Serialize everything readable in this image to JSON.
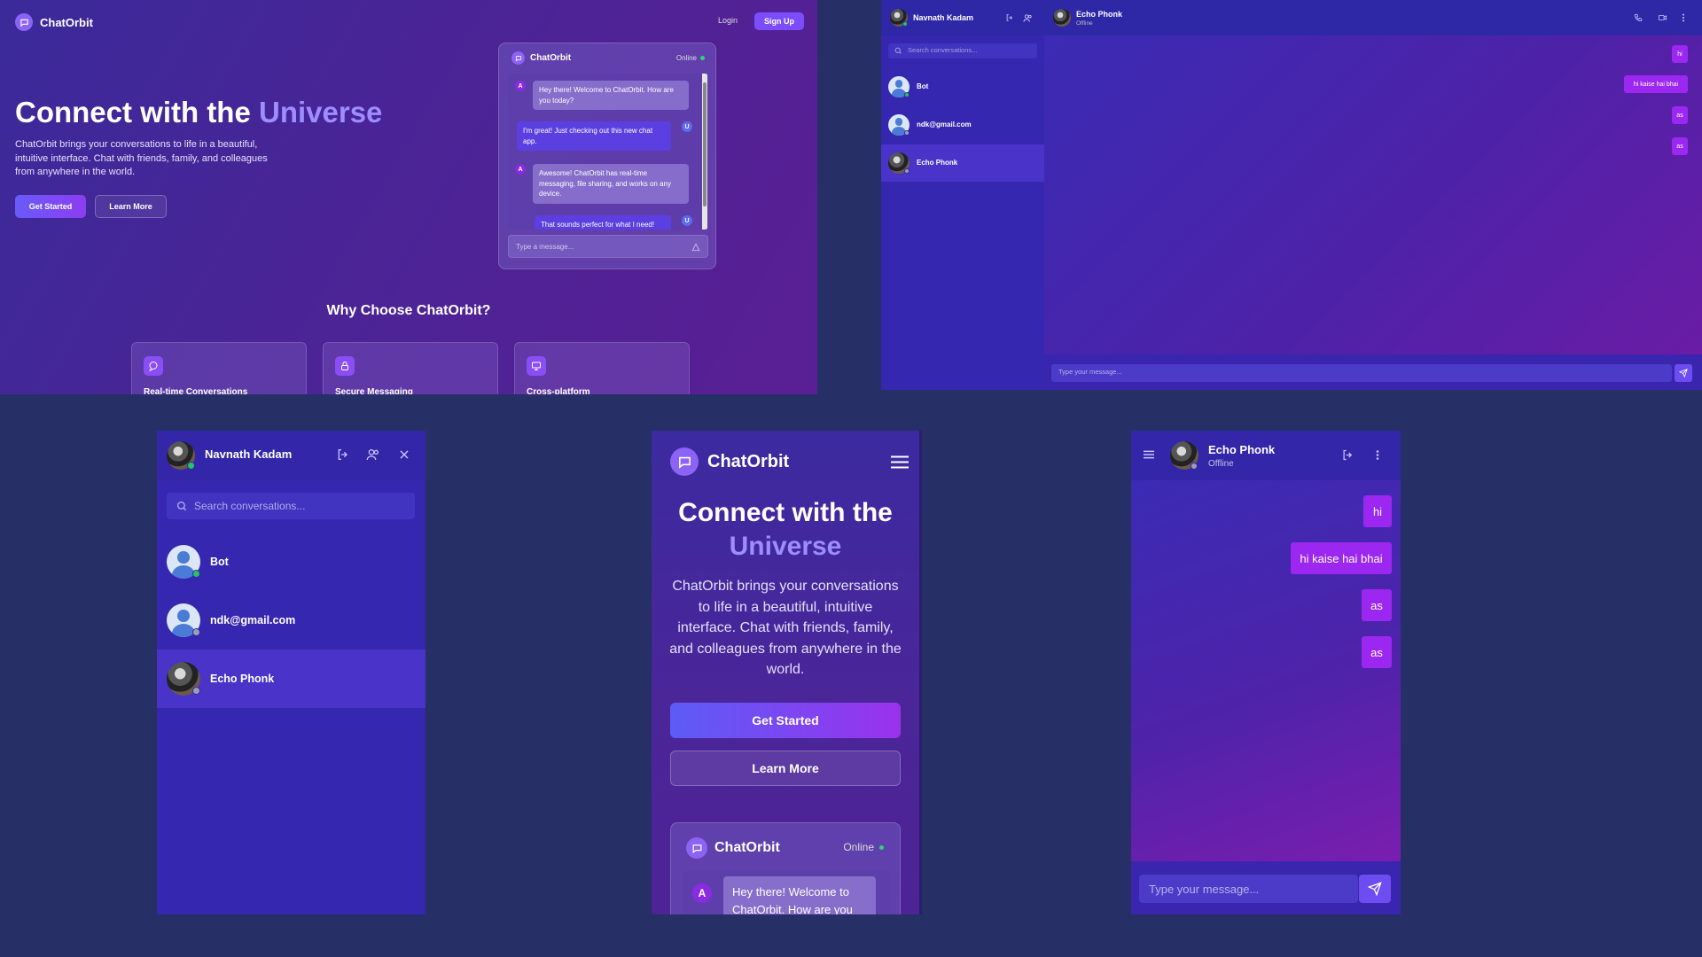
{
  "app": {
    "brand": "ChatOrbit"
  },
  "landing": {
    "nav": {
      "login": "Login",
      "signup": "Sign Up"
    },
    "hero": {
      "title_prefix": "Connect with the",
      "title_accent": "Universe",
      "description": "ChatOrbit brings your conversations to life in a beautiful, intuitive interface. Chat with friends, family, and colleagues from anywhere in the world.",
      "get_started": "Get Started",
      "learn_more": "Learn More"
    },
    "preview": {
      "title": "ChatOrbit",
      "status": "Online",
      "messages": [
        {
          "from": "bot",
          "avatar": "A",
          "text": "Hey there! Welcome to ChatOrbit. How are you today?"
        },
        {
          "from": "user",
          "avatar": "U",
          "text": "I'm great! Just checking out this new chat app."
        },
        {
          "from": "bot",
          "avatar": "A",
          "text": "Awesome! ChatOrbit has real-time messaging, file sharing, and works on any device."
        },
        {
          "from": "user",
          "avatar": "U",
          "text": "That sounds perfect for what I need!"
        }
      ],
      "input_placeholder": "Type a message..."
    },
    "why_title": "Why Choose ChatOrbit?",
    "features": [
      {
        "icon": "chat-bubble-icon",
        "title": "Real-time Conversations"
      },
      {
        "icon": "lock-icon",
        "title": "Secure Messaging"
      },
      {
        "icon": "monitor-icon",
        "title": "Cross-platform"
      }
    ]
  },
  "chat": {
    "user": {
      "name": "Navnath Kadam"
    },
    "search_placeholder": "Search conversations...",
    "conversations": [
      {
        "name": "Bot",
        "online": true,
        "avatar": "default"
      },
      {
        "name": "ndk@gmail.com",
        "online": false,
        "avatar": "default"
      },
      {
        "name": "Echo Phonk",
        "online": false,
        "avatar": "photo",
        "active": true
      }
    ],
    "active": {
      "name": "Echo Phonk",
      "status": "Offline"
    },
    "messages": [
      "hi",
      "hi kaise hai bhai",
      "as",
      "as"
    ],
    "input_placeholder": "Type your message...",
    "colors": {
      "sent_bubble": "#9b27f0",
      "accent": "#6d4cf2"
    }
  }
}
